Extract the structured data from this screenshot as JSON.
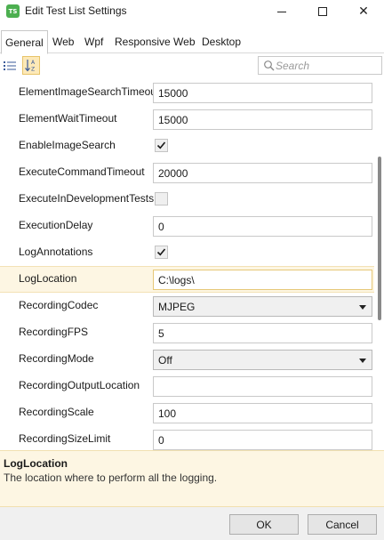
{
  "window": {
    "icon_text": "TS",
    "title": "Edit Test List Settings"
  },
  "tabs": [
    {
      "label": "General",
      "active": true
    },
    {
      "label": "Web",
      "active": false
    },
    {
      "label": "Wpf",
      "active": false
    },
    {
      "label": "Responsive Web",
      "active": false
    },
    {
      "label": "Desktop",
      "active": false
    }
  ],
  "toolbar": {
    "categorized_icon": "list-icon",
    "alphabetical_icon": "sort-az-icon",
    "search_placeholder": "Search"
  },
  "properties": [
    {
      "name": "ElementImageSearchTimeout",
      "type": "text",
      "value": "15000"
    },
    {
      "name": "ElementWaitTimeout",
      "type": "text",
      "value": "15000"
    },
    {
      "name": "EnableImageSearch",
      "type": "checkbox",
      "checked": true
    },
    {
      "name": "ExecuteCommandTimeout",
      "type": "text",
      "value": "20000"
    },
    {
      "name": "ExecuteInDevelopmentTests",
      "type": "checkbox",
      "checked": false
    },
    {
      "name": "ExecutionDelay",
      "type": "text",
      "value": "0"
    },
    {
      "name": "LogAnnotations",
      "type": "checkbox",
      "checked": true
    },
    {
      "name": "LogLocation",
      "type": "text",
      "value": "C:\\logs\\",
      "selected": true
    },
    {
      "name": "RecordingCodec",
      "type": "select",
      "value": "MJPEG"
    },
    {
      "name": "RecordingFPS",
      "type": "text",
      "value": "5"
    },
    {
      "name": "RecordingMode",
      "type": "select",
      "value": "Off"
    },
    {
      "name": "RecordingOutputLocation",
      "type": "text",
      "value": ""
    },
    {
      "name": "RecordingScale",
      "type": "text",
      "value": "100"
    },
    {
      "name": "RecordingSizeLimit",
      "type": "text",
      "value": "0"
    }
  ],
  "description": {
    "title": "LogLocation",
    "text": "The location where to perform all the logging."
  },
  "footer": {
    "ok_label": "OK",
    "cancel_label": "Cancel"
  },
  "colors": {
    "selected_row": "#fdf6e3",
    "app_icon": "#4caf50",
    "sort_button_active": "#fde9b8"
  }
}
